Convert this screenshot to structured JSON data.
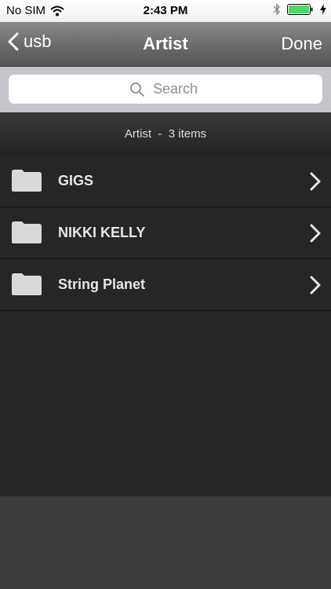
{
  "status_bar": {
    "carrier": "No SIM",
    "time": "2:43 PM",
    "icons": [
      "wifi-icon",
      "bluetooth-icon",
      "battery-icon",
      "charging-icon"
    ]
  },
  "nav": {
    "back_label": "usb",
    "title": "Artist",
    "done_label": "Done"
  },
  "search": {
    "placeholder": "Search",
    "value": ""
  },
  "section": {
    "label": "Artist  -  3 items"
  },
  "list": {
    "items": [
      {
        "label": "GIGS"
      },
      {
        "label": "NIKKI KELLY"
      },
      {
        "label": "String Planet"
      }
    ]
  },
  "colors": {
    "battery": "#4cd964",
    "folder": "#d9d9d9",
    "row_background": "#262626"
  }
}
